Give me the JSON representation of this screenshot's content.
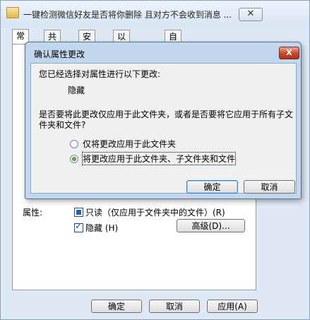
{
  "properties_window": {
    "title": "一键检测微信好友是否将你删除 且对方不会收到消息 ...",
    "close_glyph": "✕",
    "tabs": [
      {
        "label": "常规",
        "active": true
      },
      {
        "label": "共享",
        "active": false
      },
      {
        "label": "安全",
        "active": false
      },
      {
        "label": "以前的版本",
        "active": false
      },
      {
        "label": "自定义",
        "active": false
      }
    ],
    "attributes_label": "属性:",
    "readonly_label": "只读（仅应用于文件夹中的文件）(R)",
    "readonly_state": "indeterminate",
    "hidden_label": "隐藏 (H)",
    "hidden_state": "checked",
    "advanced_button": "高级(D)...",
    "ok_button": "确定",
    "cancel_button": "取消",
    "apply_button": "应用(A)"
  },
  "confirm_dialog": {
    "title": "确认属性更改",
    "close_glyph": "X",
    "intro": "您已经选择对属性进行以下更改:",
    "change": "隐藏",
    "question_line1": "是否要将此更改仅应用于此文件夹，或者是否要将它应用于所有子文",
    "question_line2": "件夹和文件?",
    "options": [
      {
        "label": "仅将更改应用于此文件夹",
        "selected": false
      },
      {
        "label": "将更改应用于此文件夹、子文件夹和文件",
        "selected": true
      }
    ],
    "ok_button": "确定",
    "cancel_button": "取消"
  }
}
